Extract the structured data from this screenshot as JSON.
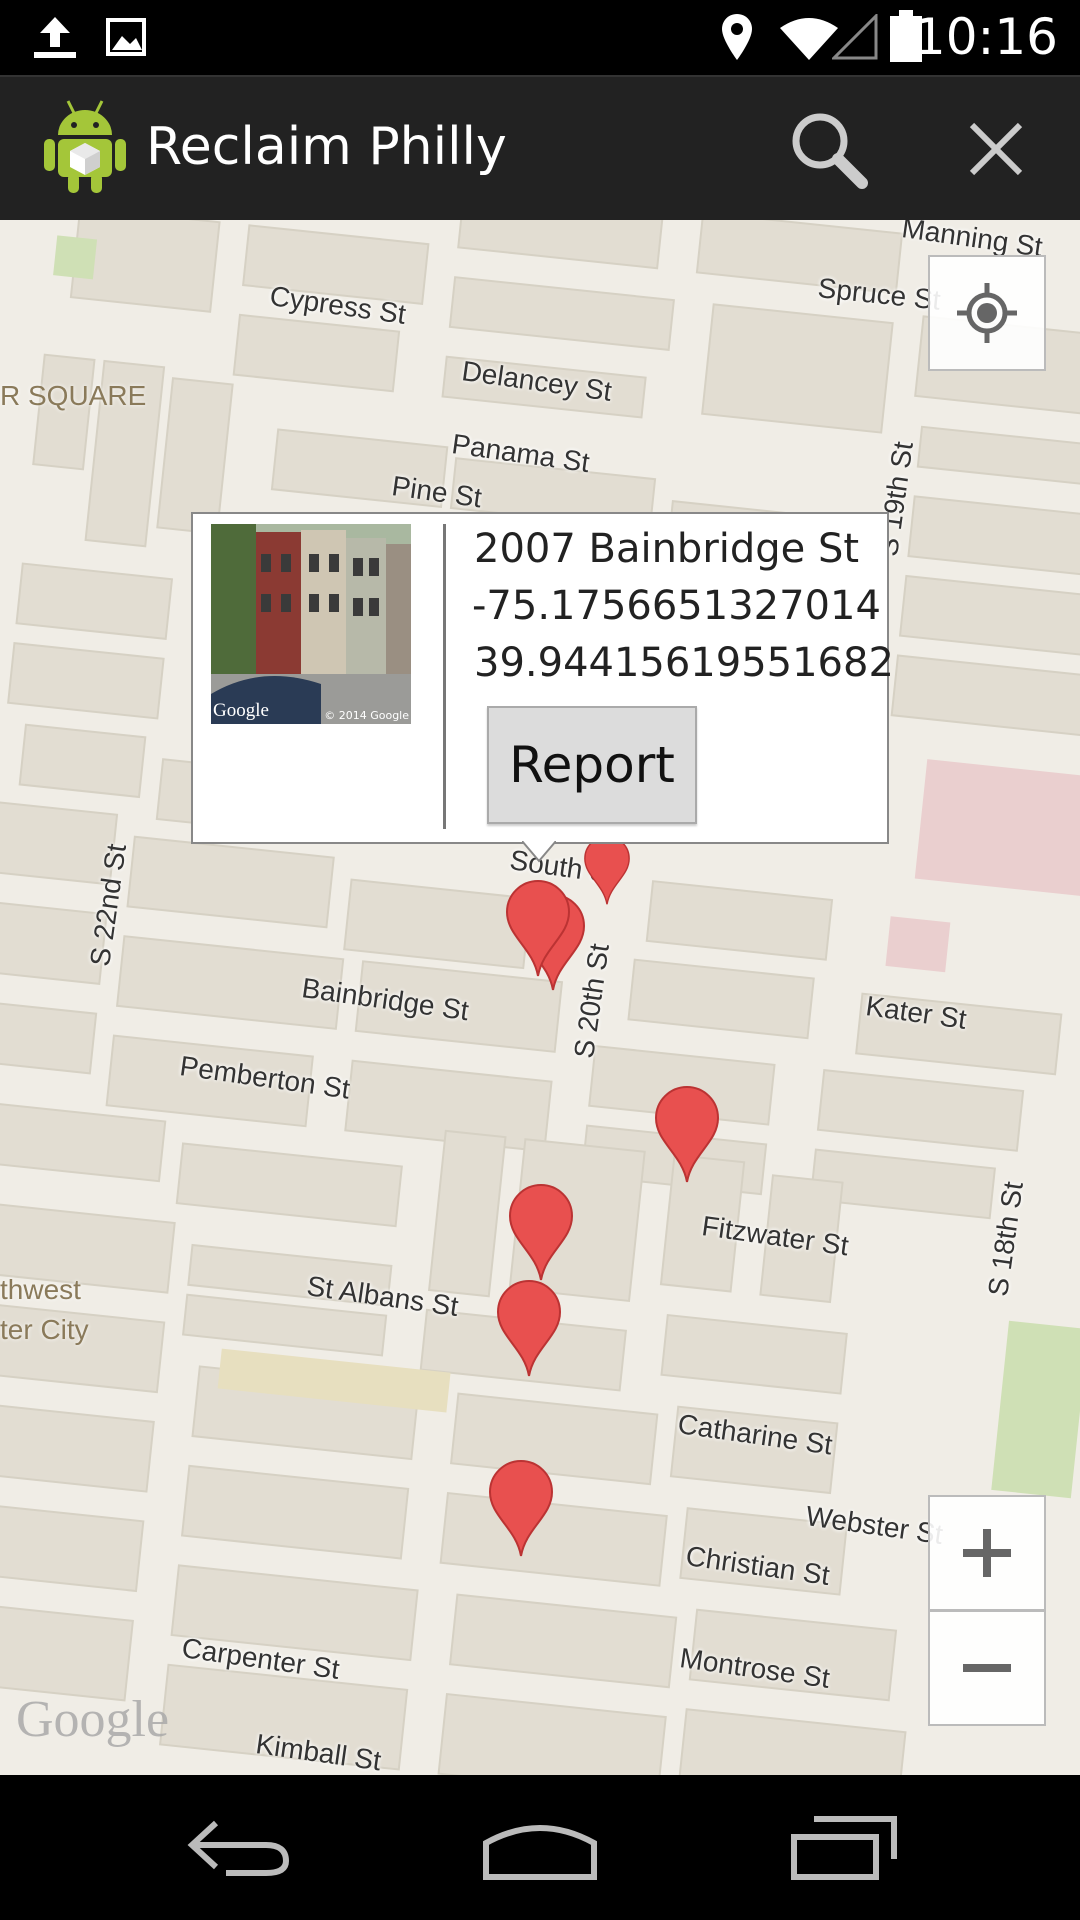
{
  "status_bar": {
    "time": "10:16",
    "left_icons": [
      "upload-icon",
      "image-icon"
    ],
    "right_icons": [
      "location-icon",
      "wifi-icon",
      "signal-icon",
      "battery-icon"
    ]
  },
  "action_bar": {
    "title": "Reclaim Philly",
    "app_icon": "android-app-icon",
    "actions": [
      "search-icon",
      "close-icon"
    ]
  },
  "map": {
    "streets": [
      {
        "label": "Manning St"
      },
      {
        "label": "Cypress St"
      },
      {
        "label": "Spruce St"
      },
      {
        "label": "Delancey St"
      },
      {
        "label": "Panama St"
      },
      {
        "label": "Pine St"
      },
      {
        "label": "S 19th St"
      },
      {
        "label": "S 22nd St"
      },
      {
        "label": "South St"
      },
      {
        "label": "S 20th St"
      },
      {
        "label": "Bainbridge St"
      },
      {
        "label": "Kater St"
      },
      {
        "label": "Pemberton St"
      },
      {
        "label": "Fitzwater St"
      },
      {
        "label": "S 18th St"
      },
      {
        "label": "St Albans St"
      },
      {
        "label": "Catharine St"
      },
      {
        "label": "Webster St"
      },
      {
        "label": "Christian St"
      },
      {
        "label": "Montrose St"
      },
      {
        "label": "Carpenter St"
      },
      {
        "label": "Kimball St"
      }
    ],
    "districts": [
      {
        "label": "R SQUARE"
      },
      {
        "label": "thwest"
      },
      {
        "label": "ter City"
      }
    ],
    "google_logo": "Google",
    "controls": [
      "my-location-icon",
      "zoom-in-icon",
      "zoom-out-icon"
    ],
    "marker_color": "#e8504f"
  },
  "info_window": {
    "address": "2007 Bainbridge St",
    "longitude": "-75.1756651327014",
    "latitude": "39.94415619551682",
    "report_label": "Report",
    "thumb_watermark": "Google",
    "thumb_copyright": "© 2014 Google"
  },
  "nav_bar": {
    "buttons": [
      "back-icon",
      "home-icon",
      "recents-icon"
    ]
  }
}
